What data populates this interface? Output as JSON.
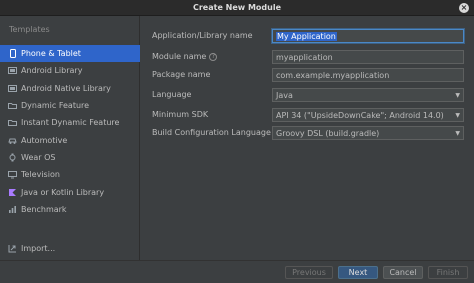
{
  "window": {
    "title": "Create New Module"
  },
  "sidebar": {
    "heading": "Templates",
    "items": [
      {
        "label": "Phone & Tablet",
        "icon": "phone-icon",
        "selected": true
      },
      {
        "label": "Android Library",
        "icon": "library-icon"
      },
      {
        "label": "Android Native Library",
        "icon": "library-icon"
      },
      {
        "label": "Dynamic Feature",
        "icon": "folder-icon"
      },
      {
        "label": "Instant Dynamic Feature",
        "icon": "folder-icon"
      },
      {
        "label": "Automotive",
        "icon": "car-icon"
      },
      {
        "label": "Wear OS",
        "icon": "watch-icon"
      },
      {
        "label": "Television",
        "icon": "tv-icon"
      },
      {
        "label": "Java or Kotlin Library",
        "icon": "kotlin-icon"
      },
      {
        "label": "Benchmark",
        "icon": "chart-icon"
      }
    ],
    "import_label": "Import..."
  },
  "form": {
    "app_name_label": "Application/Library name",
    "app_name_value": "My Application",
    "module_name_label": "Module name",
    "module_name_value": "myapplication",
    "package_name_label": "Package name",
    "package_name_value": "com.example.myapplication",
    "language_label": "Language",
    "language_value": "Java",
    "min_sdk_label": "Minimum SDK",
    "min_sdk_value": "API 34 (\"UpsideDownCake\"; Android 14.0)",
    "build_config_label": "Build Configuration Language",
    "build_config_value": "Groovy DSL (build.gradle)"
  },
  "footer": {
    "previous": "Previous",
    "next": "Next",
    "cancel": "Cancel",
    "finish": "Finish"
  }
}
